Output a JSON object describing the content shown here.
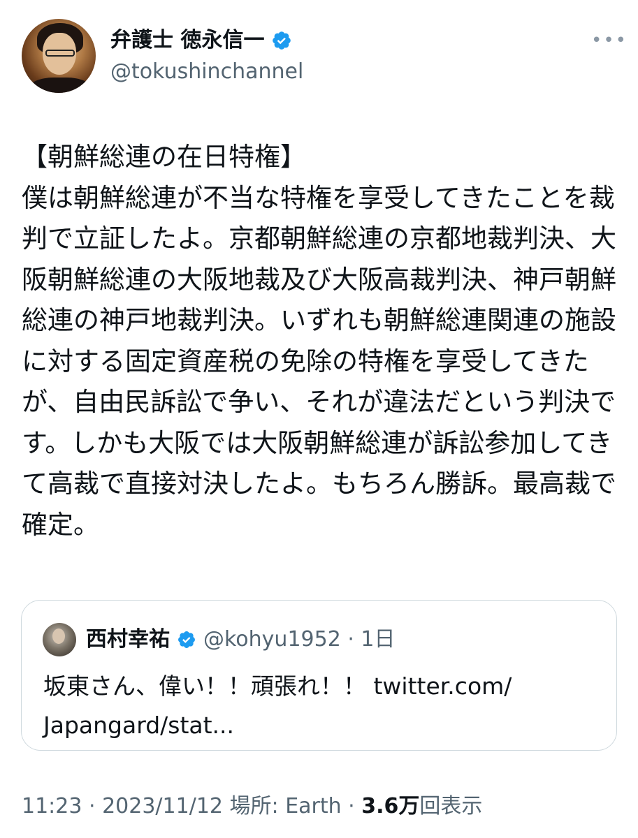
{
  "author": {
    "display_name": "弁護士 徳永信一",
    "handle": "@tokushinchannel",
    "verified": true,
    "verified_color": "#1d9bf0"
  },
  "menu": {
    "more_icon": "more-horizontal-icon",
    "label": "•••"
  },
  "tweet": {
    "text": "【朝鮮総連の在日特権】\n僕は朝鮮総連が不当な特権を享受してきたことを裁判で立証したよ。京都朝鮮総連の京都地裁判決、大阪朝鮮総連の大阪地裁及び大阪高裁判決、神戸朝鮮総連の神戸地裁判決。いずれも朝鮮総連関連の施設に対する固定資産税の免除の特権を享受してきたが、自由民訴訟で争い、それが違法だという判決です。しかも大阪では大阪朝鮮総連が訴訟参加してきて高裁で直接対決したよ。もちろん勝訴。最高裁で確定。"
  },
  "quote": {
    "display_name": "西村幸祐",
    "verified": true,
    "handle_time": "@kohyu1952 · 1日",
    "text": "坂東さん、偉い！！頑張れ！！ twitter.com/\nJapangard/stat..."
  },
  "footer": {
    "time": "11:23",
    "date": "2023/11/12",
    "location": "場所: Earth",
    "views_count": "3.6万",
    "views_label": "回表示",
    "separator": " · "
  }
}
